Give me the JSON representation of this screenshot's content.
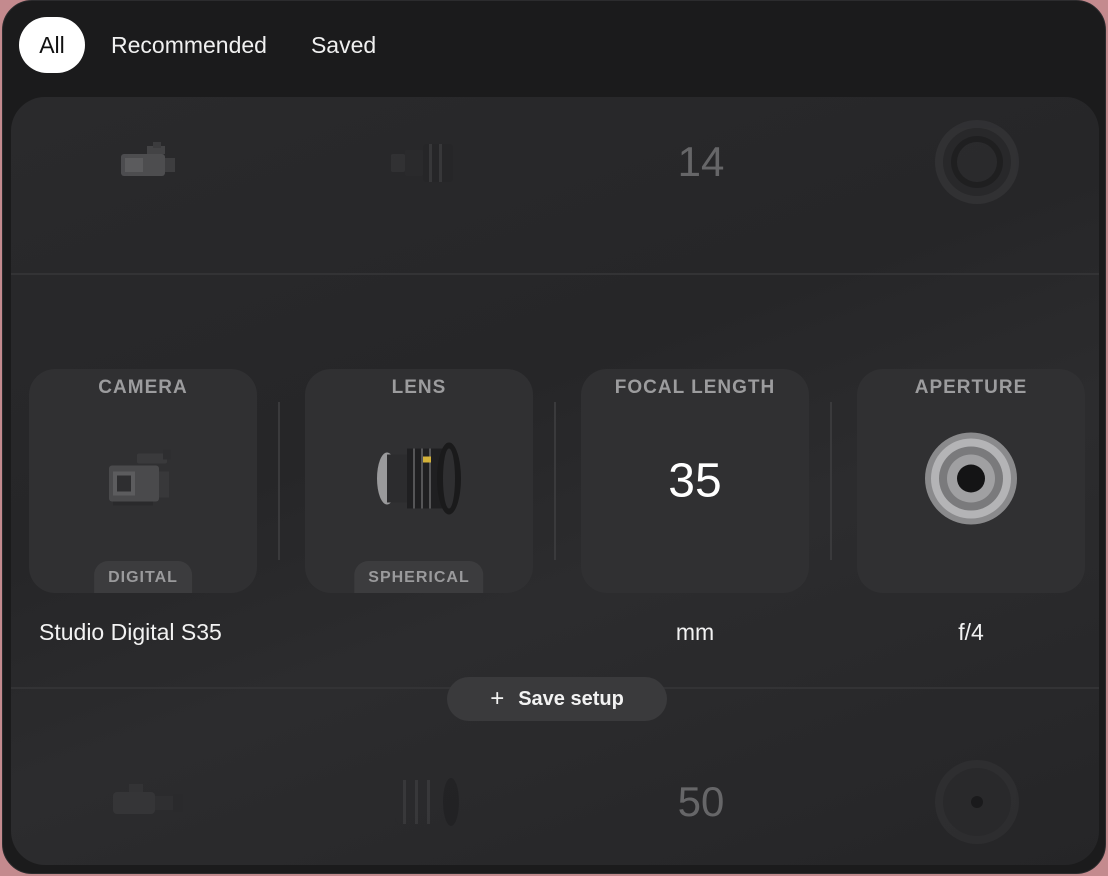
{
  "tabs": [
    {
      "label": "All",
      "active": true
    },
    {
      "label": "Recommended",
      "active": false
    },
    {
      "label": "Saved",
      "active": false
    }
  ],
  "rows": {
    "previous": {
      "focal_length": "14"
    },
    "next": {
      "focal_length": "50"
    }
  },
  "current": {
    "camera": {
      "title": "CAMERA",
      "badge": "DIGITAL",
      "caption": "Studio Digital S35",
      "icon": "cinema-camera-icon"
    },
    "lens": {
      "title": "LENS",
      "badge": "SPHERICAL",
      "caption": "",
      "icon": "cine-lens-icon"
    },
    "focal_length": {
      "title": "FOCAL LENGTH",
      "value": "35",
      "caption": "mm"
    },
    "aperture": {
      "title": "APERTURE",
      "caption": "f/4",
      "icon": "aperture-ring-icon"
    }
  },
  "save_button": {
    "label": "Save setup",
    "icon": "plus-icon"
  }
}
